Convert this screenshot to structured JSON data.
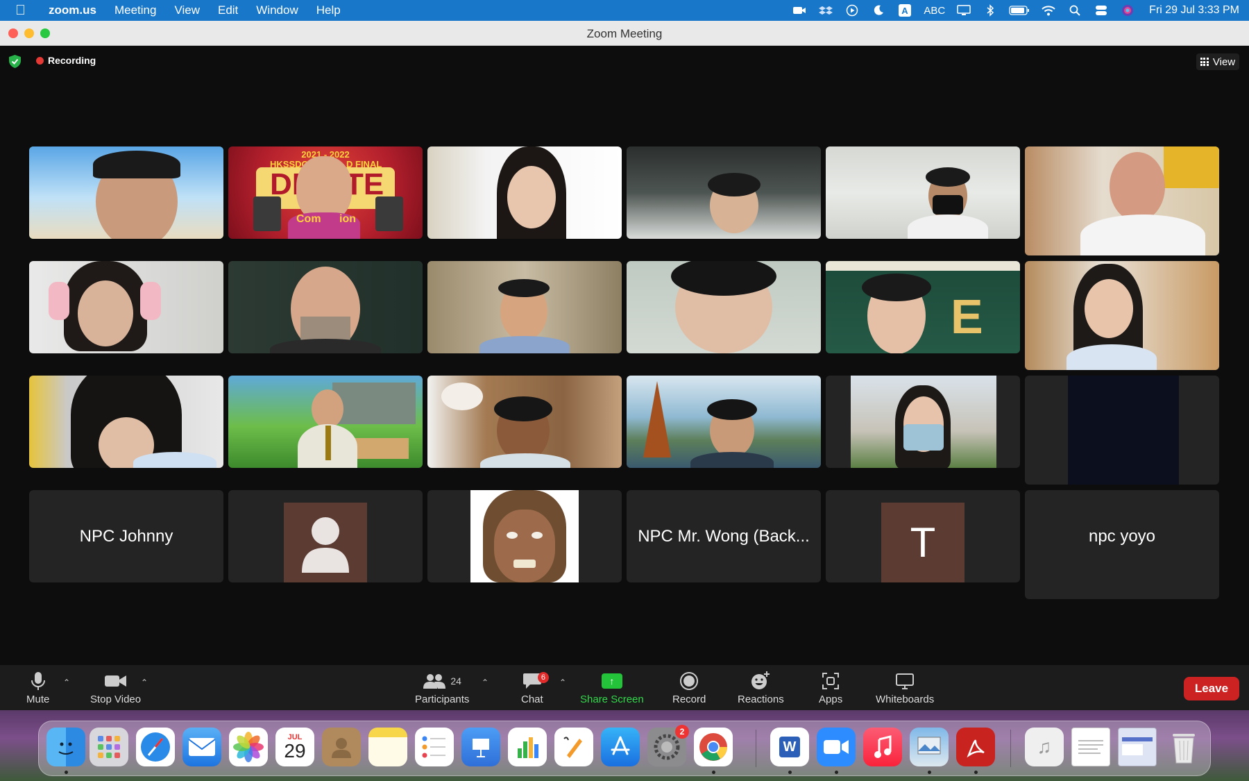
{
  "menubar": {
    "app_name": "zoom.us",
    "menus": [
      "Meeting",
      "View",
      "Edit",
      "Window",
      "Help"
    ],
    "input_source": "ABC",
    "clock": "Fri 29 Jul  3:33 PM"
  },
  "window": {
    "title": "Zoom Meeting"
  },
  "meeting": {
    "recording_label": "Recording",
    "view_label": "View",
    "name_tiles": {
      "npc_johnny": "NPC Johnny",
      "npc_mr_wong": "NPC Mr. Wong (Back...",
      "npc_yoyo": "npc yoyo",
      "avatar_t": "T"
    },
    "banner": {
      "year": "2021 - 2022",
      "line1": "HKSSDC G",
      "line1b": "D FINAL",
      "big": "DE",
      "big2": "TE",
      "sub": "Com",
      "sub2": "ion"
    }
  },
  "toolbar": {
    "mute": "Mute",
    "stop_video": "Stop Video",
    "participants": "Participants",
    "participant_count": "24",
    "chat": "Chat",
    "chat_badge": "6",
    "share_screen": "Share Screen",
    "record": "Record",
    "reactions": "Reactions",
    "apps": "Apps",
    "whiteboards": "Whiteboards",
    "leave": "Leave"
  },
  "dock": {
    "calendar_month": "JUL",
    "calendar_day": "29",
    "settings_badge": "2",
    "word_letter": "W"
  }
}
